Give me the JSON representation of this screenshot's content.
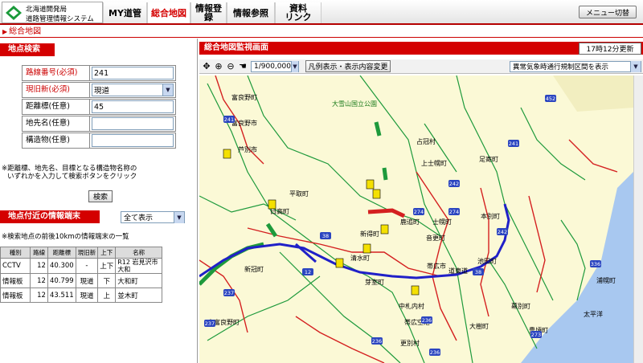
{
  "header": {
    "logo_line1": "北海道開発局",
    "logo_line2": "道路管理情報システム",
    "nav": [
      "MY道管",
      "総合地図",
      "情報登録",
      "情報参照",
      "資料\nリンク"
    ],
    "active_nav": "総合地図",
    "menu_button": "メニュー切替"
  },
  "breadcrumb": "総合地図",
  "search_panel": {
    "title": "地点検索",
    "fields": [
      {
        "label": "路線番号(必須)",
        "value": "241",
        "required": true
      },
      {
        "label": "現旧新(必須)",
        "value": "現道",
        "required": true
      },
      {
        "label": "距離標(任意)",
        "value": "45",
        "required": false
      },
      {
        "label": "地先名(任意)",
        "value": "",
        "required": false
      },
      {
        "label": "構造物(任意)",
        "value": "",
        "required": false
      }
    ],
    "note_line1": "※距離標、地先名、目標となる構造物名称の",
    "note_line2": "いずれかを入力して検索ボタンをクリック",
    "search_button": "検索"
  },
  "terminal_panel": {
    "title": "地点付近の情報端末",
    "filter_value": "全て表示",
    "note": "※検索地点の前後10kmの情報端末の一覧",
    "columns": [
      "種別",
      "路線",
      "距離標",
      "現旧新",
      "上下",
      "名称"
    ],
    "rows": [
      [
        "CCTV",
        "12",
        "40.300",
        "-",
        "上下",
        "R12 岩見沢市大和"
      ],
      [
        "情報板",
        "12",
        "40.799",
        "現道",
        "下",
        "大和町"
      ],
      [
        "情報板",
        "12",
        "43.511",
        "現道",
        "上",
        "並木町"
      ]
    ]
  },
  "map_panel": {
    "title": "総合地図監視画面",
    "update_button": "17時12分更新",
    "scale_value": "1/900,000",
    "legend_button": "凡例表示・表示内容変更",
    "region_select": "異常気象時通行規制区間を表示"
  },
  "map_labels": {
    "park": "大雪山国立公園",
    "places": [
      "富良野市",
      "富良野町",
      "上士幌町",
      "足寄町",
      "本別町",
      "池田町",
      "幕別町",
      "中札内村",
      "大樹町",
      "更別村",
      "帯広市",
      "芽室町",
      "清水町",
      "新得町",
      "鹿追町",
      "士幌町",
      "音更町",
      "浦幌町",
      "豊頃町",
      "新冠町",
      "日高町",
      "平取町",
      "占冠村",
      "南富良野町",
      "芦別市",
      "帯広空港",
      "太平洋",
      "道東道"
    ],
    "routes": [
      "241",
      "241",
      "242",
      "242",
      "274",
      "274",
      "38",
      "38",
      "236",
      "236",
      "336",
      "237",
      "237",
      "273",
      "452",
      "12",
      "236"
    ]
  },
  "colors": {
    "accent": "#d40000",
    "map_bg": "#fbf9d6"
  }
}
